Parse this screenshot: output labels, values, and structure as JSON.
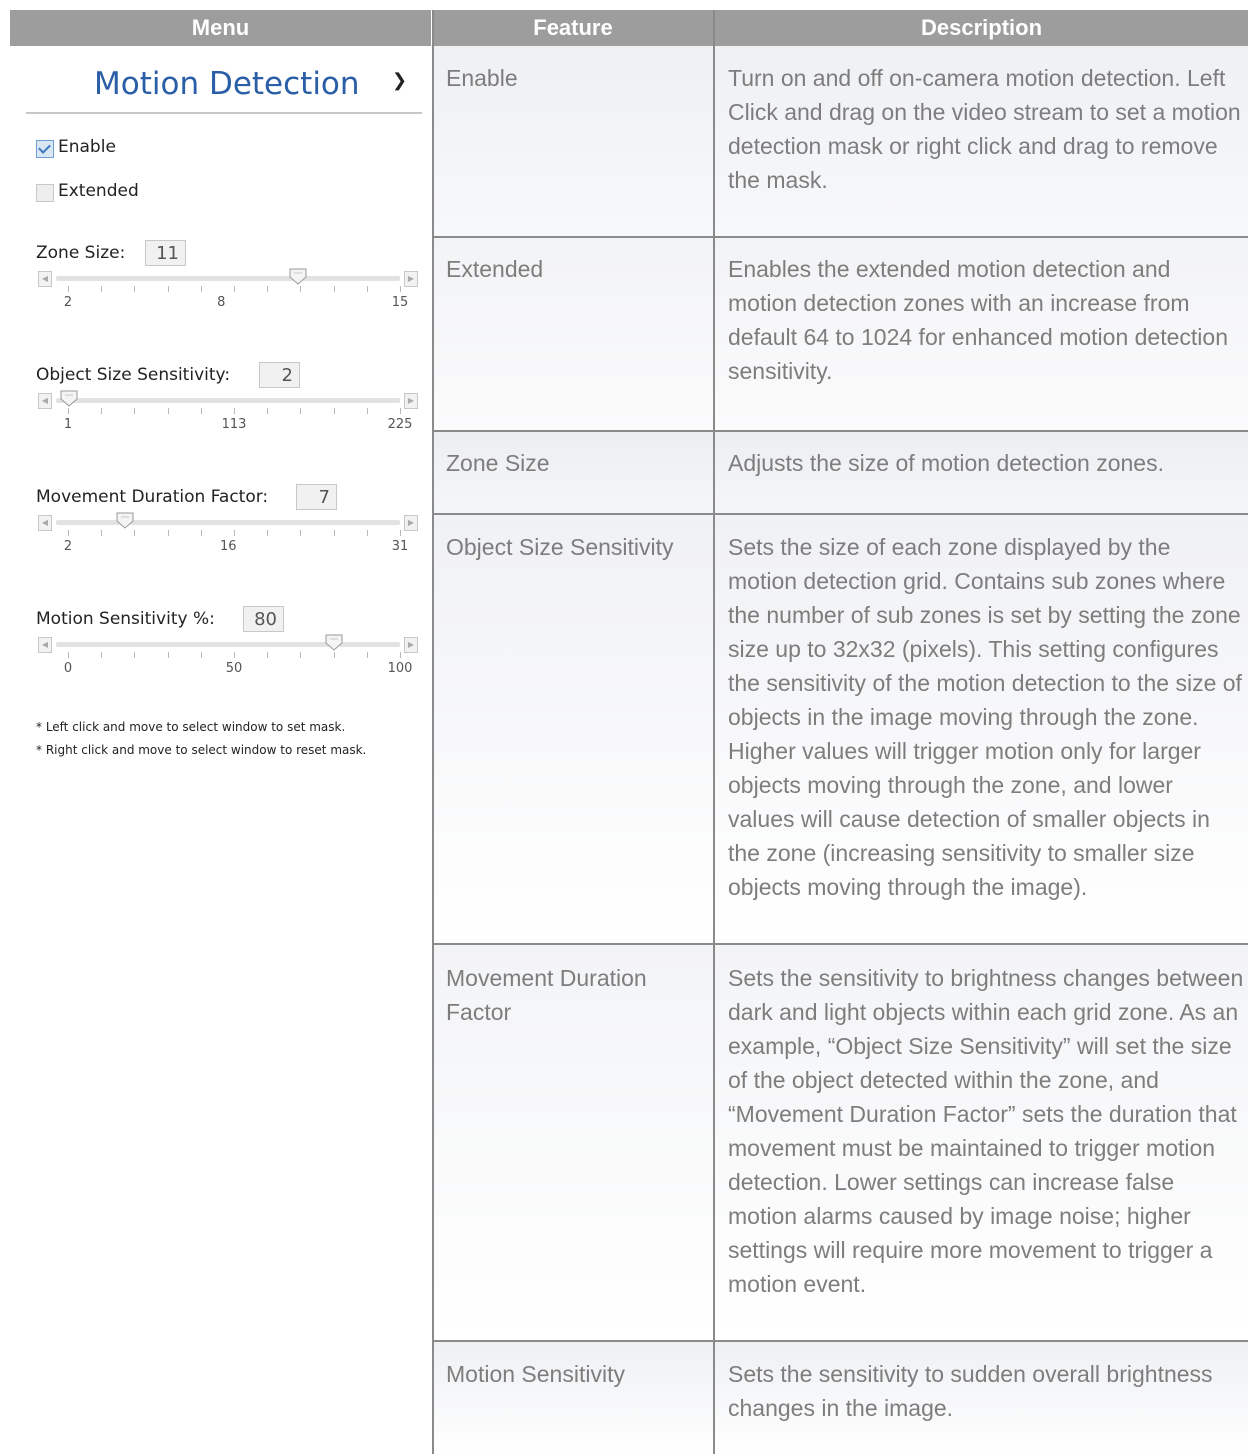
{
  "header": {
    "menu": "Menu",
    "feature": "Feature",
    "description": "Description"
  },
  "panel": {
    "title": "Motion Detection",
    "enable_label": "Enable",
    "enable_checked": true,
    "extended_label": "Extended",
    "extended_checked": false,
    "sliders": [
      {
        "label": "Zone Size:",
        "value": "11",
        "min": 2,
        "max": 15,
        "mid": 8,
        "current": 11,
        "tick_labels": [
          "2",
          "8",
          "15"
        ]
      },
      {
        "label": "Object Size Sensitivity:",
        "value": "2",
        "min": 1,
        "max": 225,
        "mid": 113,
        "current": 2,
        "tick_labels": [
          "1",
          "113",
          "225"
        ]
      },
      {
        "label": "Movement Duration Factor:",
        "value": "7",
        "min": 2,
        "max": 31,
        "mid": 16,
        "current": 7,
        "tick_labels": [
          "2",
          "16",
          "31"
        ]
      },
      {
        "label": "Motion Sensitivity %:",
        "value": "80",
        "min": 0,
        "max": 100,
        "mid": 50,
        "current": 80,
        "tick_labels": [
          "0",
          "50",
          "100"
        ]
      }
    ],
    "notes": [
      "* Left click and move to select window to set mask.",
      "* Right click and move to select window to reset mask."
    ]
  },
  "rows": [
    {
      "feature": "Enable",
      "description": "Turn on and off on-camera motion detection. Left Click and drag on the video stream to set a motion detection mask or right click and drag to remove the mask."
    },
    {
      "feature": "Extended",
      "description": "Enables the extended motion detection and motion detection zones with an increase from default 64 to 1024 for enhanced motion detection sensitivity."
    },
    {
      "feature": "Zone Size",
      "description": "Adjusts the size of motion detection zones."
    },
    {
      "feature": "Object Size Sensitivity",
      "description": "Sets the size of each zone displayed by the motion detection grid. Contains sub zones where the number of sub zones is set by setting the zone size up to 32x32 (pixels). This setting configures the sensitivity of the motion detection to the size of objects in the image moving through the zone. Higher values will trigger motion only for larger objects moving through the zone, and lower values will cause detection of smaller objects in the zone (increasing sensitivity to smaller size objects moving through the image)."
    },
    {
      "feature": "Movement Duration Factor",
      "description": "Sets the sensitivity to brightness changes between dark and light objects within each grid zone. As an example, “Object Size Sensitivity” will set the size of the object detected within the zone, and “Movement Duration Factor” sets the duration that movement must be maintained to trigger motion detection. Lower settings can increase false motion alarms caused by image noise; higher settings will require more movement to trigger a motion event."
    },
    {
      "feature": "Motion Sensitivity",
      "description": "Sets the sensitivity to sudden overall brightness changes in the image."
    }
  ]
}
